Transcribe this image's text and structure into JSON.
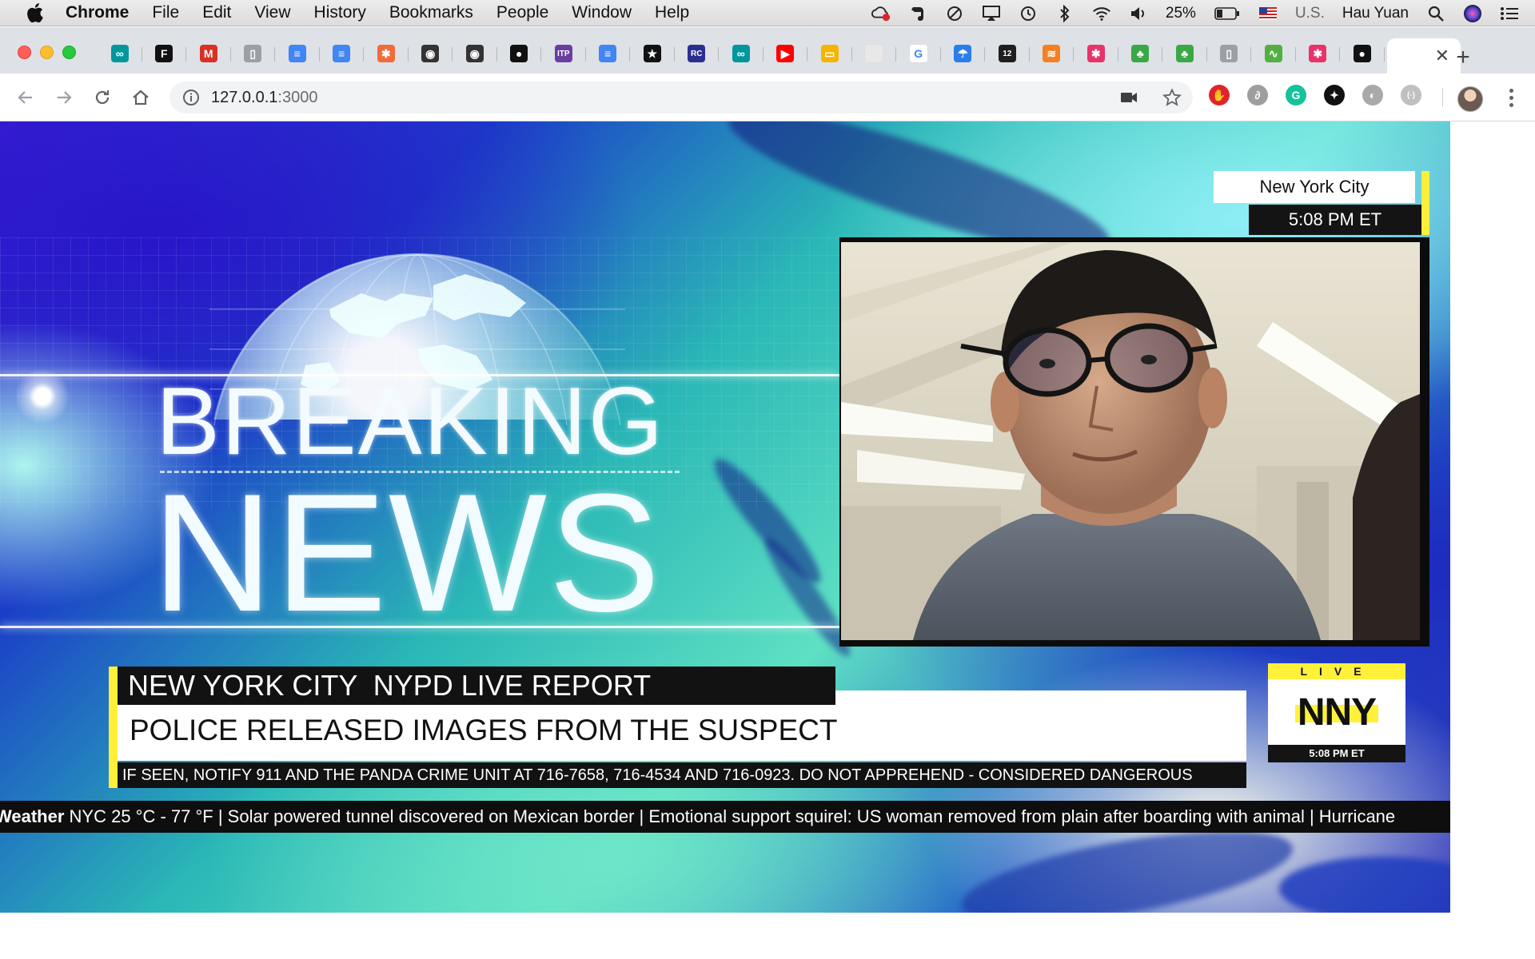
{
  "menubar": {
    "app": "Chrome",
    "items": [
      "File",
      "Edit",
      "View",
      "History",
      "Bookmarks",
      "People",
      "Window",
      "Help"
    ],
    "battery": "25%",
    "input_source": "U.S.",
    "user": "Hau Yuan"
  },
  "browser": {
    "url_host": "127.0.0.1",
    "url_port": ":3000",
    "pinned_tabs": [
      {
        "icon": "arduino-icon",
        "color": "#00979c",
        "glyph": "∞"
      },
      {
        "icon": "framer-icon",
        "color": "#111111",
        "glyph": "F"
      },
      {
        "icon": "gmail-icon",
        "color": "#d93025",
        "glyph": "M"
      },
      {
        "icon": "document-icon",
        "color": "#9aa0a6",
        "glyph": "▯"
      },
      {
        "icon": "google-docs-icon",
        "color": "#4285f4",
        "glyph": "≡"
      },
      {
        "icon": "google-docs-icon",
        "color": "#4285f4",
        "glyph": "≡"
      },
      {
        "icon": "pinwheel-icon",
        "color": "#f26b3a",
        "glyph": "✱"
      },
      {
        "icon": "robot-icon",
        "color": "#333333",
        "glyph": "◉"
      },
      {
        "icon": "robot-icon",
        "color": "#333333",
        "glyph": "◉"
      },
      {
        "icon": "github-icon",
        "color": "#111111",
        "glyph": "●"
      },
      {
        "icon": "itp-icon",
        "color": "#6a3ea1",
        "glyph": "ITP"
      },
      {
        "icon": "google-docs-icon",
        "color": "#4285f4",
        "glyph": "≡"
      },
      {
        "icon": "star-icon",
        "color": "#111111",
        "glyph": "★"
      },
      {
        "icon": "rc-icon",
        "color": "#2a2f8f",
        "glyph": "RC"
      },
      {
        "icon": "arduino-icon",
        "color": "#00979c",
        "glyph": "∞"
      },
      {
        "icon": "youtube-icon",
        "color": "#ff0000",
        "glyph": "▶"
      },
      {
        "icon": "slides-icon",
        "color": "#f4b400",
        "glyph": "▭"
      },
      {
        "icon": "blank-tab-icon",
        "color": "#e8e8e8",
        "glyph": ""
      },
      {
        "icon": "google-icon",
        "color": "#ffffff",
        "glyph": "G"
      },
      {
        "icon": "umbrella-icon",
        "color": "#2b7de9",
        "glyph": "☂"
      },
      {
        "icon": "twelve-icon",
        "color": "#1f1f1f",
        "glyph": "12"
      },
      {
        "icon": "stackoverflow-icon",
        "color": "#f48024",
        "glyph": "≋"
      },
      {
        "icon": "asterisk-icon",
        "color": "#e8336b",
        "glyph": "✱"
      },
      {
        "icon": "leaf-icon",
        "color": "#3aa845",
        "glyph": "♣"
      },
      {
        "icon": "leaf-icon",
        "color": "#3aa845",
        "glyph": "♣"
      },
      {
        "icon": "document-icon",
        "color": "#9aa0a6",
        "glyph": "▯"
      },
      {
        "icon": "chart-icon",
        "color": "#52b043",
        "glyph": "∿"
      },
      {
        "icon": "asterisk-icon",
        "color": "#e8336b",
        "glyph": "✱"
      },
      {
        "icon": "github-icon",
        "color": "#111111",
        "glyph": "●"
      }
    ],
    "extensions": [
      {
        "icon": "adblock-icon",
        "color": "#e0242b",
        "glyph": "✋"
      },
      {
        "icon": "grey-extension-icon",
        "color": "#9e9e9e",
        "glyph": "∂"
      },
      {
        "icon": "grammarly-icon",
        "color": "#15c39a",
        "glyph": "G"
      },
      {
        "icon": "pin-extension-icon",
        "color": "#111111",
        "glyph": "✦"
      },
      {
        "icon": "circle-extension-icon",
        "color": "#a9a9a9",
        "glyph": "◐"
      },
      {
        "icon": "bracket-extension-icon",
        "color": "#c0c0c0",
        "glyph": "(·)"
      }
    ]
  },
  "broadcast": {
    "background_text_line1": "BREAKING",
    "background_text_line2": "NEWS",
    "location": "New York City",
    "time": "5:08 PM ET",
    "lower_third": {
      "headline": "NEW YORK CITY  NYPD LIVE REPORT",
      "main": "POLICE RELEASED IMAGES FROM THE SUSPECT",
      "sub": "IF SEEN, NOTIFY 911 AND THE PANDA CRIME UNIT AT 716-7658, 716-4534 AND 716-0923. DO NOT APPREHEND - CONSIDERED DANGEROUS"
    },
    "live_badge": {
      "label": "LIVE",
      "logo": "NNY",
      "time": "5:08 PM ET"
    },
    "ticker": {
      "label": "Weather",
      "text": " NYC 25 °C - 77 °F |  Solar powered tunnel discovered on Mexican border | Emotional support squirel: US woman removed from plain after boarding with animal | Hurricane"
    },
    "colors": {
      "accent_yellow": "#ffef3a",
      "bar_black": "#121212"
    }
  }
}
